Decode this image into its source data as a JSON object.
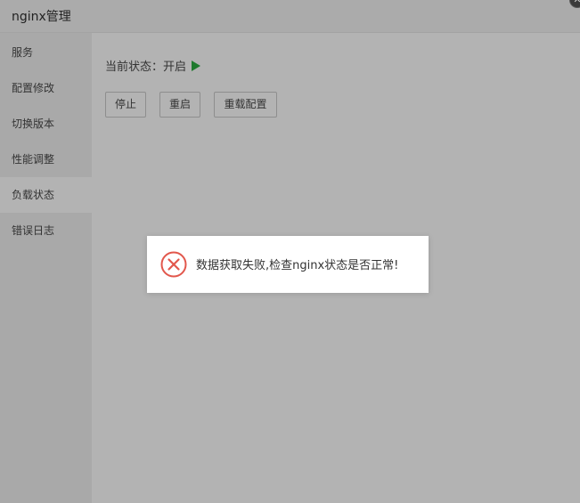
{
  "window": {
    "title": "nginx管理",
    "close_label": "✕"
  },
  "sidebar": {
    "items": [
      {
        "label": "服务",
        "active": false
      },
      {
        "label": "配置修改",
        "active": false
      },
      {
        "label": "切换版本",
        "active": false
      },
      {
        "label": "性能调整",
        "active": false
      },
      {
        "label": "负载状态",
        "active": true
      },
      {
        "label": "错误日志",
        "active": false
      }
    ]
  },
  "main": {
    "status_label": "当前状态：开启",
    "status_icon": "play-icon",
    "status_color": "#1f7a2e",
    "buttons": {
      "stop": "停止",
      "restart": "重启",
      "reload": "重载配置"
    }
  },
  "toast": {
    "icon": "error-circle-icon",
    "icon_color": "#e2574c",
    "message": "数据获取失败,检查nginx状态是否正常!"
  }
}
